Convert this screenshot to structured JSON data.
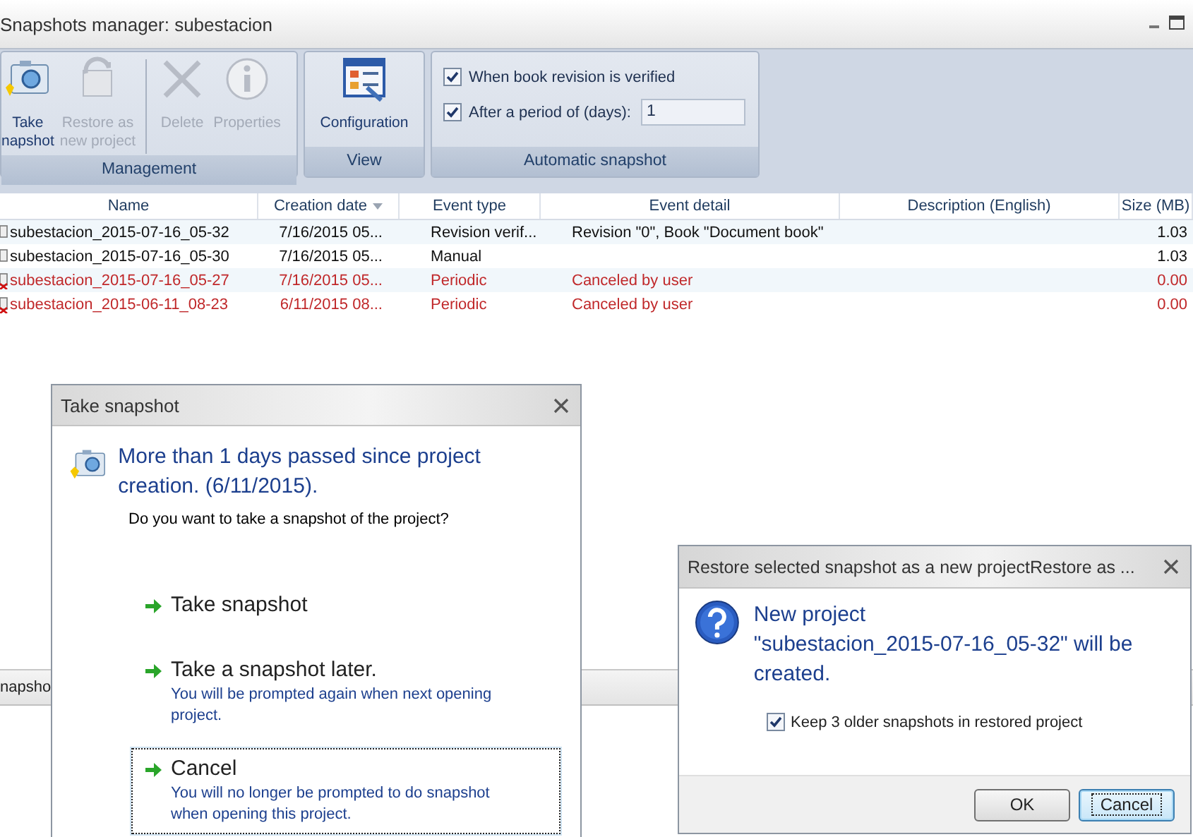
{
  "window": {
    "title": "Snapshots manager: subestacion"
  },
  "ribbon": {
    "groups": [
      {
        "kind": "buttons",
        "label": "Management",
        "buttons": [
          {
            "kind": "camera",
            "lines": [
              "Take",
              "napshot"
            ],
            "disabled": false
          },
          {
            "kind": "restore",
            "lines": [
              "Restore as",
              "new project"
            ],
            "disabled": true
          },
          {
            "kind": "delete",
            "lines": [
              "Delete"
            ],
            "disabled": true
          },
          {
            "kind": "properties",
            "lines": [
              "Properties"
            ],
            "disabled": true
          }
        ]
      },
      {
        "kind": "buttons",
        "label": "View",
        "buttons": [
          {
            "kind": "configuration",
            "lines": [
              "Configuration"
            ],
            "disabled": false
          }
        ]
      },
      {
        "kind": "options",
        "label": "Automatic snapshot",
        "options": [
          {
            "label": "When book revision is verified",
            "checked": true
          },
          {
            "label": "After a period of (days):",
            "checked": true,
            "value": "1"
          }
        ]
      }
    ]
  },
  "table": {
    "columns": [
      {
        "label": "Name",
        "sorted": false
      },
      {
        "label": "Creation date",
        "sorted": true
      },
      {
        "label": "Event type",
        "sorted": false
      },
      {
        "label": "Event detail",
        "sorted": false
      },
      {
        "label": "Description (English)",
        "sorted": false
      },
      {
        "label": "Size (MB)",
        "sorted": false
      }
    ],
    "rows": [
      {
        "kind": "normal",
        "cells": [
          "subestacion_2015-07-16_05-32",
          "7/16/2015 05...",
          "Revision verif...",
          "Revision \"0\", Book \"Document book\"",
          "",
          "1.03"
        ]
      },
      {
        "kind": "normal",
        "cells": [
          "subestacion_2015-07-16_05-30",
          "7/16/2015 05...",
          "Manual",
          "",
          "",
          "1.03"
        ]
      },
      {
        "kind": "canceled",
        "cells": [
          "subestacion_2015-07-16_05-27",
          "7/16/2015 05...",
          "Periodic",
          "Canceled by user",
          "",
          "0.00"
        ]
      },
      {
        "kind": "canceled",
        "cells": [
          "subestacion_2015-06-11_08-23",
          "6/11/2015 08...",
          "Periodic",
          "Canceled by user",
          "",
          "0.00"
        ]
      }
    ]
  },
  "status_bar": {
    "text": "napsho"
  },
  "take_snapshot_dialog": {
    "title": "Take snapshot",
    "heading": "More than 1 days passed since project creation. (6/11/2015).",
    "question": "Do you want to take a snapshot of the project?",
    "options": [
      {
        "title": "Take snapshot",
        "focused": false
      },
      {
        "title": "Take a snapshot later.",
        "note": "You will be prompted again when next opening project.",
        "focused": false
      },
      {
        "title": "Cancel",
        "note": "You will no longer be prompted to do snapshot when opening this project.",
        "focused": true
      }
    ]
  },
  "restore_dialog": {
    "title": "Restore selected snapshot as a new projectRestore as ...",
    "message_lines": [
      "New project",
      "\"subestacion_2015-07-16_05-32\" will be",
      "created."
    ],
    "checkbox": {
      "label": "Keep 3 older snapshots in restored project",
      "checked": true
    },
    "buttons": [
      {
        "label": "OK",
        "focused": false
      },
      {
        "label": "Cancel",
        "focused": true
      }
    ]
  }
}
